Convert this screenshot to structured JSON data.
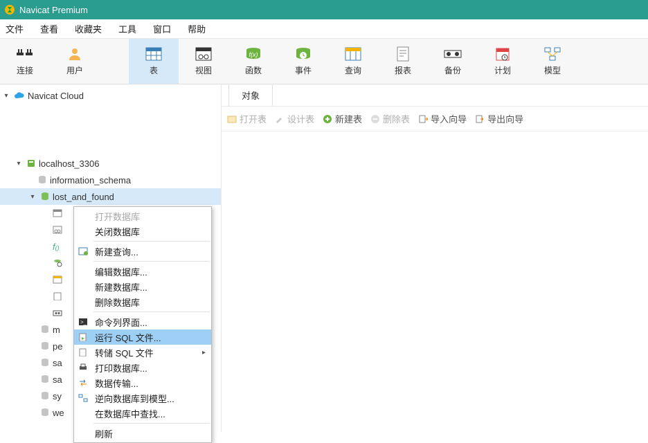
{
  "window": {
    "title": "Navicat Premium"
  },
  "menubar": {
    "file": "文件",
    "view": "查看",
    "favorites": "收藏夹",
    "tools": "工具",
    "window": "窗口",
    "help": "帮助"
  },
  "toolbar": {
    "connect": "连接",
    "user": "用户",
    "table": "表",
    "view": "视图",
    "function": "函数",
    "event": "事件",
    "query": "查询",
    "report": "报表",
    "backup": "备份",
    "schedule": "计划",
    "model": "模型"
  },
  "sidebar": {
    "cloud": "Navicat Cloud",
    "conn": "localhost_3306",
    "dbs": {
      "info": "information_schema",
      "lost": "lost_and_found"
    },
    "cropped": {
      "m": "m",
      "pe": "pe",
      "sa": "sa",
      "sa2": "sa",
      "sy": "sy",
      "we": "we"
    }
  },
  "tabs": {
    "objects": "对象"
  },
  "actionbar": {
    "open": "打开表",
    "design": "设计表",
    "new": "新建表",
    "delete": "删除表",
    "import": "导入向导",
    "export": "导出向导"
  },
  "context": {
    "open_db": "打开数据库",
    "close_db": "关闭数据库",
    "new_query": "新建查询...",
    "edit_db": "编辑数据库...",
    "new_db": "新建数据库...",
    "del_db": "删除数据库",
    "cli": "命令列界面...",
    "run_sql": "运行 SQL 文件...",
    "dump_sql": "转储 SQL 文件",
    "print_db": "打印数据库...",
    "transfer": "数据传输...",
    "reverse": "逆向数据库到模型...",
    "find_in_db": "在数据库中查找...",
    "refresh": "刷新"
  }
}
